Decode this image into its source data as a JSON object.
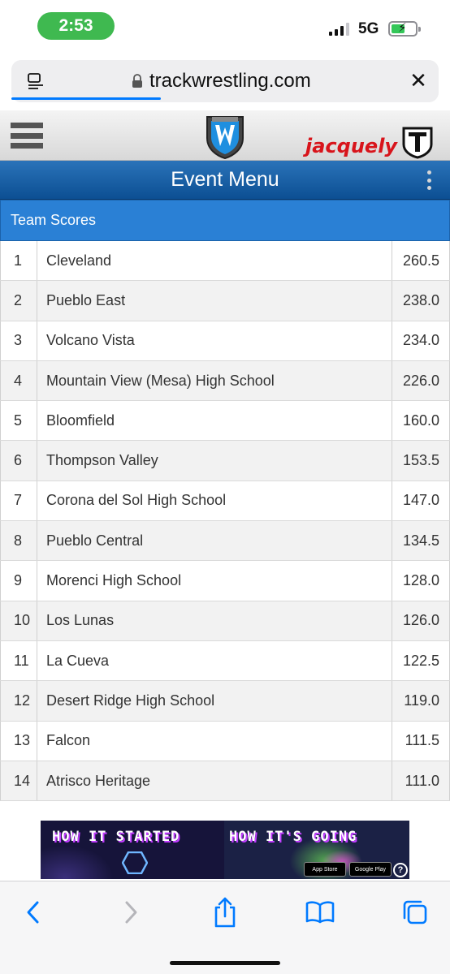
{
  "status_bar": {
    "time": "2:53",
    "network": "5G",
    "icons": [
      "signal-icon",
      "battery-charging-icon"
    ]
  },
  "browser": {
    "url": "trackwrestling.com",
    "icons": [
      "reader-icon",
      "lock-icon",
      "close-icon"
    ]
  },
  "site_header": {
    "logo": "trackwrestling-logo",
    "sponsor_name": "jacquely",
    "icons": [
      "hamburger-menu-icon",
      "sponsor-logo-icon"
    ]
  },
  "event_menu": {
    "title": "Event Menu",
    "icons": [
      "kebab-menu-icon"
    ]
  },
  "team_scores": {
    "title": "Team Scores",
    "rows": [
      {
        "rank": "1",
        "team": "Cleveland",
        "score": "260.5"
      },
      {
        "rank": "2",
        "team": "Pueblo East",
        "score": "238.0"
      },
      {
        "rank": "3",
        "team": "Volcano Vista",
        "score": "234.0"
      },
      {
        "rank": "4",
        "team": "Mountain View (Mesa) High School",
        "score": "226.0"
      },
      {
        "rank": "5",
        "team": "Bloomfield",
        "score": "160.0"
      },
      {
        "rank": "6",
        "team": "Thompson Valley",
        "score": "153.5"
      },
      {
        "rank": "7",
        "team": "Corona del Sol High School",
        "score": "147.0"
      },
      {
        "rank": "8",
        "team": "Pueblo Central",
        "score": "134.5"
      },
      {
        "rank": "9",
        "team": "Morenci High School",
        "score": "128.0"
      },
      {
        "rank": "10",
        "team": "Los Lunas",
        "score": "126.0"
      },
      {
        "rank": "11",
        "team": "La Cueva",
        "score": "122.5"
      },
      {
        "rank": "12",
        "team": "Desert Ridge High School",
        "score": "119.0"
      },
      {
        "rank": "13",
        "team": "Falcon",
        "score": "111.5"
      },
      {
        "rank": "14",
        "team": "Atrisco Heritage",
        "score": "111.0"
      }
    ]
  },
  "ad": {
    "left_text": "HOW IT STARTED",
    "right_text": "HOW IT'S GOING",
    "badge_app_store": "App Store",
    "badge_google_play": "Google Play",
    "info_label": "?"
  },
  "toolbar": {
    "icons": [
      "back-icon",
      "forward-icon",
      "share-icon",
      "bookmarks-icon",
      "tabs-icon"
    ]
  },
  "colors": {
    "accent_blue": "#0c4f93",
    "scores_header_blue": "#2a80d5",
    "time_pill_green": "#3fb950",
    "sponsor_red": "#d8141b",
    "ios_blue": "#007aff"
  }
}
